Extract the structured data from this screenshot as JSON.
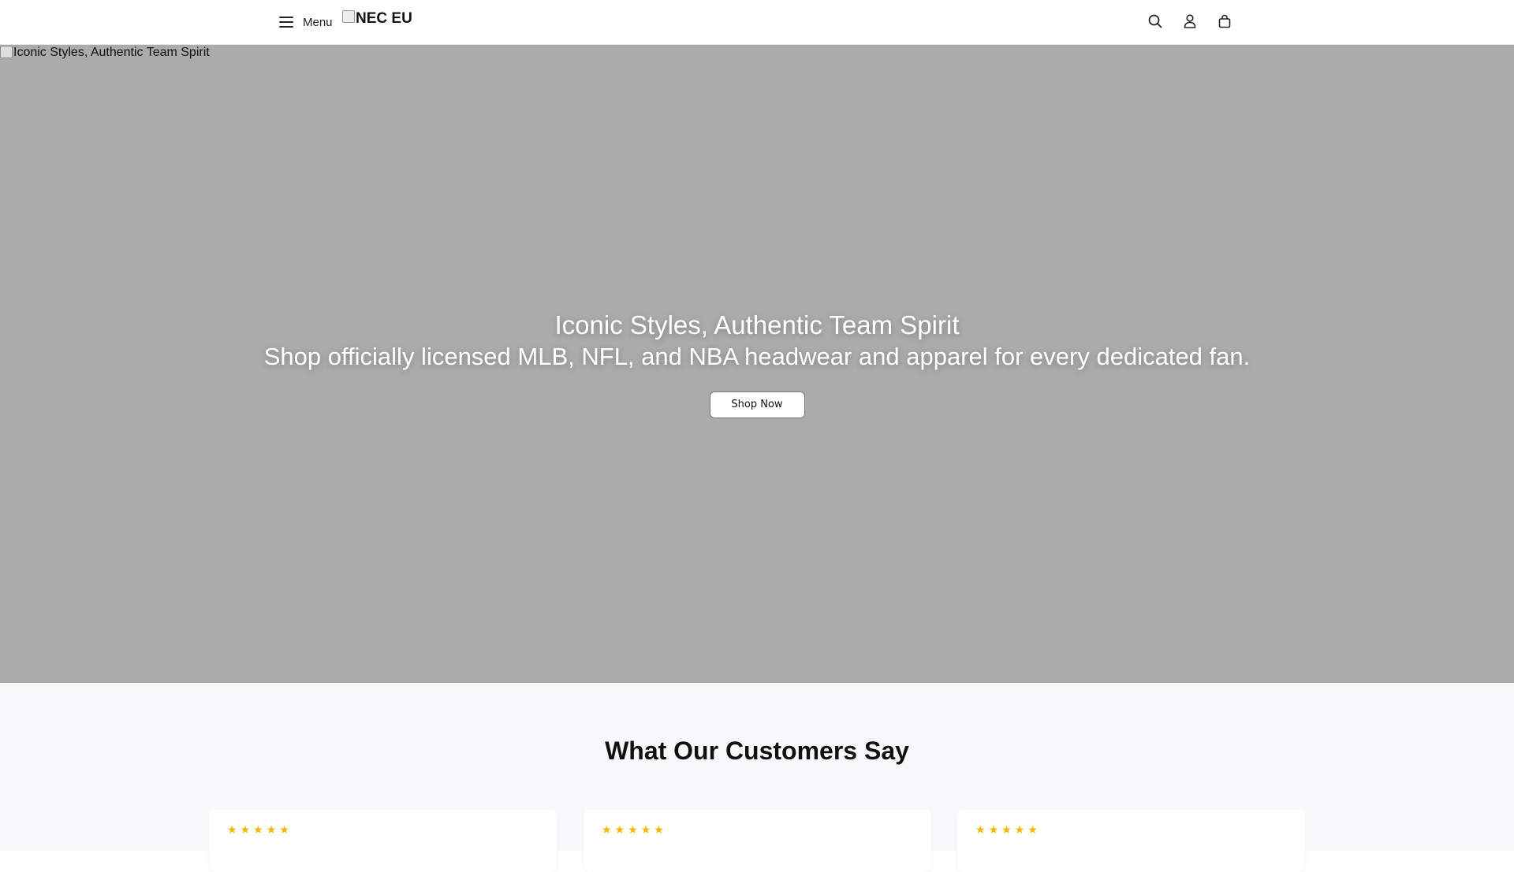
{
  "header": {
    "menu_label": "Menu",
    "menu_icon": "hamburger-icon",
    "logo_alt": "NEC EU",
    "actions": [
      {
        "name": "search-icon"
      },
      {
        "name": "account-icon"
      },
      {
        "name": "cart-icon"
      }
    ]
  },
  "hero": {
    "image_alt": "Iconic Styles, Authentic Team Spirit",
    "title": "Iconic Styles, Authentic Team Spirit",
    "subtitle": "Shop officially licensed MLB, NFL, and NBA headwear and apparel for every dedicated fan.",
    "cta_label": "Shop Now",
    "background_color": "#ababab"
  },
  "reviews": {
    "title": "What Our Customers Say",
    "cards": [
      {
        "rating": 5
      },
      {
        "rating": 5
      },
      {
        "rating": 5
      }
    ],
    "star_color": "#f5b400",
    "star_glyph": "★"
  }
}
